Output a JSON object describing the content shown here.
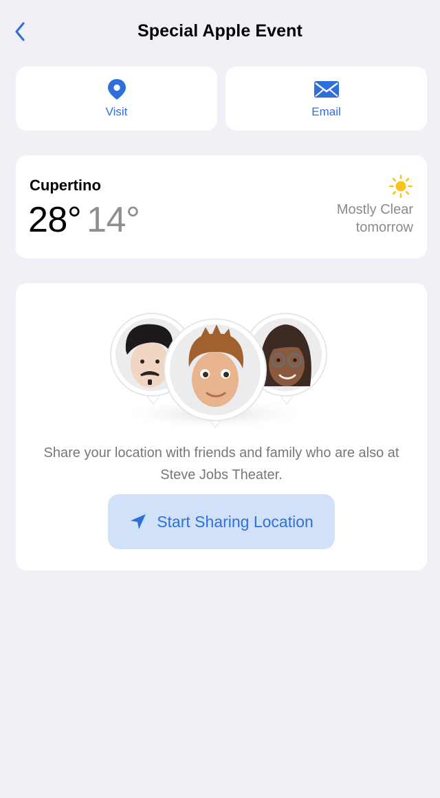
{
  "nav": {
    "title": "Special Apple Event"
  },
  "actions": {
    "visit_label": "Visit",
    "email_label": "Email"
  },
  "weather": {
    "city": "Cupertino",
    "high": "28°",
    "low": "14°",
    "condition_line1": "Mostly Clear",
    "condition_line2": "tomorrow",
    "icon": "sun-icon"
  },
  "share": {
    "description": "Share your location with friends and family who are also at Steve Jobs Theater.",
    "button_label": "Start Sharing Location",
    "avatars": [
      "memoji-left",
      "memoji-center",
      "memoji-right"
    ]
  },
  "colors": {
    "background": "#f1f0f6",
    "card": "#ffffff",
    "accent": "#2f6fdc",
    "button_bg": "#d1e1f8",
    "secondary_text": "#8e8e93",
    "sun": "#f5c518"
  }
}
